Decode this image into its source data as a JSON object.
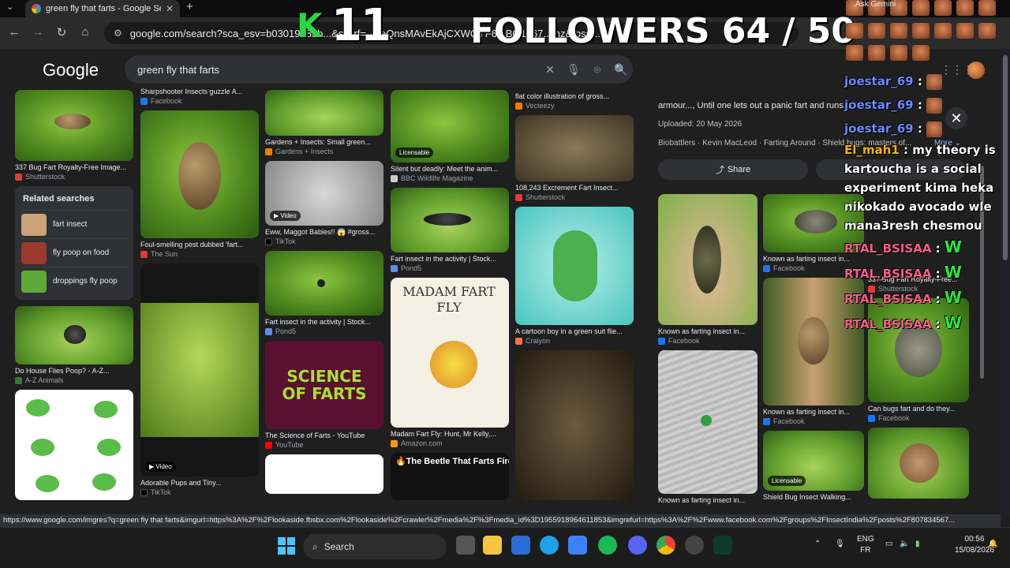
{
  "browser": {
    "tab_title": "green fly that farts - Google Se",
    "tab_close": "✕",
    "new_tab": "+",
    "url": "google.com/search?sca_esv=b03019183b...&sxsrf=...beQnsMAvEkAjCXWOYF6...BQ1867...mz&fbs=...",
    "nav": {
      "back": "←",
      "forward": "→",
      "reload": "↻",
      "home": "⌂"
    }
  },
  "overlay": {
    "k": "K",
    "eleven": "11",
    "followers": "FOLLOWERS 64 / 50",
    "ask_gemini": "Ask Gemini"
  },
  "google": {
    "logo": "Google",
    "query": "green fly that farts"
  },
  "col1": {
    "card1": {
      "caption": "337 Bug Fart Royalty-Free Image...",
      "source": "Shutterstock"
    },
    "related_title": "Related searches",
    "related": [
      "fart insect",
      "fly poop on food",
      "droppings fly poop"
    ],
    "card2": {
      "caption": "Do House Flies Poop? - A-Z...",
      "source": "A-Z Animals"
    }
  },
  "col2": {
    "card0": {
      "caption": "Sharpshooter Insects guzzle A...",
      "source": "Facebook"
    },
    "card1": {
      "caption": "Foul-smelling pest dubbed 'fart...",
      "source": "The Sun"
    },
    "card2": {
      "caption": "Adorable Pups and Tiny...",
      "source": "TikTok",
      "badge": "▶ Video"
    }
  },
  "col3": {
    "card1": {
      "caption": "Gardens + Insects: Small green...",
      "source": "Gardens + Insects"
    },
    "card2": {
      "caption": "Eww, Maggot Babies!! 😱 #gross...",
      "source": "TikTok",
      "badge": "▶ Video"
    },
    "card3": {
      "caption": "Fart insect in the activity | Stock...",
      "source": "Pond5"
    },
    "card4": {
      "caption": "The Science of Farts - YouTube",
      "source": "YouTube",
      "thumb_text": "SCIENCE OF FARTS"
    }
  },
  "col4": {
    "card1": {
      "caption": "Silent but deadly: Meet the anim...",
      "source": "BBC Wildlife Magazine",
      "badge": "Licensable"
    },
    "card2": {
      "caption": "Fart insect in the activity | Stock...",
      "source": "Pond5"
    },
    "card3": {
      "caption": "Madam Fart Fly: Hunt, Mr Kelly,...",
      "source": "Amazon.com",
      "thumb_text": "MADAM FART FLY"
    },
    "card4": {
      "thumb_text": "🔥The Beetle That Farts Fire🔥"
    }
  },
  "col5": {
    "card0": {
      "caption": "flat color illustration of gross...",
      "source": "Vecteezy"
    },
    "card1": {
      "caption": "108,243 Excrement Fart Insect...",
      "source": "Shutterstock"
    },
    "card2": {
      "caption": "A cartoon boy in a green suit flie...",
      "source": "Craiyon"
    }
  },
  "panel": {
    "desc": "armour..., Until one lets out a panic fart and runs...",
    "uploaded": "Uploaded: 20 May 2026",
    "meta": "Biobattlers · Kevin MacLeod · Farting Around · Shield bugs: masters of...",
    "more": "More ⌄",
    "share": "Share",
    "close": "✕",
    "items": [
      {
        "caption": "Known as farting insect in...",
        "source": "Facebook"
      },
      {
        "caption": "Known as farting insect in...",
        "source": "Facebook"
      },
      {
        "caption": "337 Bug Fart Royalty-Free...",
        "source": "Shutterstock"
      },
      {
        "caption": "Known as farting insect in...",
        "source": "Facebook"
      },
      {
        "caption": "Known as farting insect in...",
        "source": "Facebook"
      },
      {
        "caption": "Can bugs fart and do they...",
        "source": "Facebook"
      },
      {
        "caption": "Known as farting insect in...",
        "source": ""
      },
      {
        "caption": "Shield Bug Insect Walking...",
        "source": "",
        "badge": "Licensable"
      }
    ]
  },
  "chat": [
    {
      "user": "joestar_69",
      "msg": ""
    },
    {
      "user": "joestar_69",
      "msg": ""
    },
    {
      "user": "joestar_69",
      "msg": ""
    },
    {
      "user": "El_mah1",
      "msg": "my theory is"
    },
    {
      "user": "",
      "msg": "kartoucha is a social"
    },
    {
      "user": "",
      "msg": "experiment kima heka"
    },
    {
      "user": "",
      "msg": "nikokado avocado wle"
    },
    {
      "user": "",
      "msg": "mana3resh chesmou"
    },
    {
      "user": "RTAL_BSISAA",
      "msg": "W"
    },
    {
      "user": "RTAL_BSISAA",
      "msg": "W"
    },
    {
      "user": "RTAL_BSISAA",
      "msg": "W"
    },
    {
      "user": "RTAL_BSISAA",
      "msg": "W"
    }
  ],
  "status_url": "https://www.google.com/imgres?q=green fly that farts&imgurl=https%3A%2F%2Flookaside.fbsbx.com%2Flookaside%2Fcrawler%2Fmedia%2F%3Fmedia_id%3D1955918964611853&imgrefurl=https%3A%2F%2Fwww.facebook.com%2Fgroups%2FInsectIndia%2Fposts%2F807834567...",
  "taskbar": {
    "search": "Search",
    "lang1": "ENG",
    "lang2": "FR",
    "time": "00:56",
    "date": "15/08/2026"
  }
}
